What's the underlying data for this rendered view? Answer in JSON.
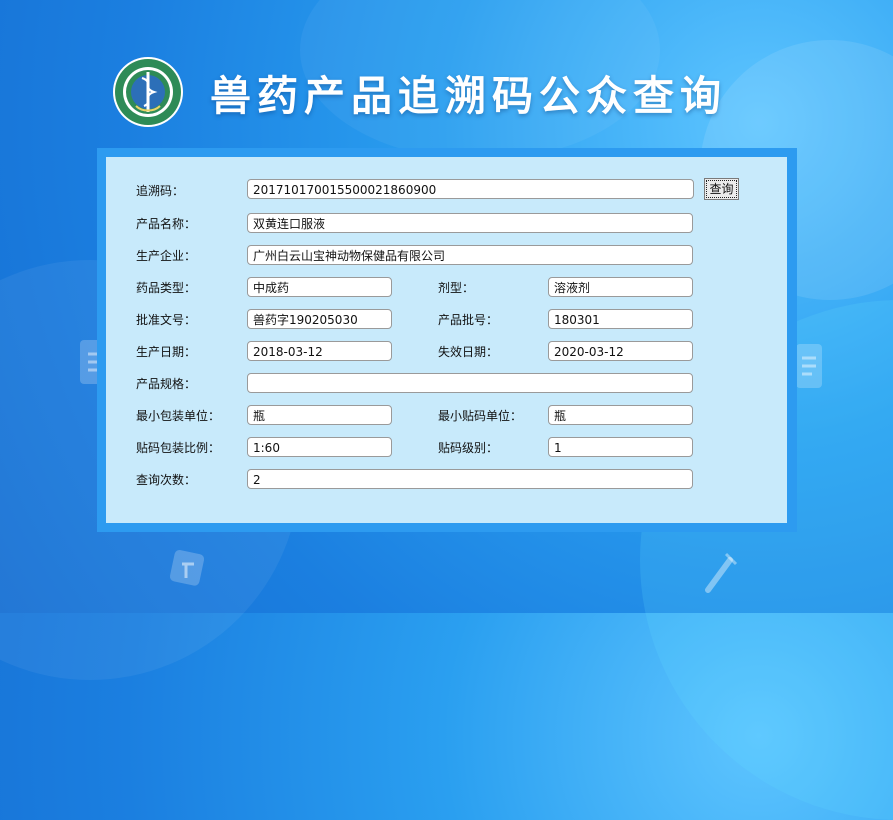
{
  "header": {
    "title": "兽药产品追溯码公众查询",
    "logo_name": "official-seal-logo"
  },
  "query": {
    "button_label": "查询"
  },
  "labels": {
    "trace_code": "追溯码：",
    "product_name": "产品名称：",
    "manufacturer": "生产企业：",
    "drug_type": "药品类型：",
    "dosage_form": "剂型：",
    "approval_no": "批准文号：",
    "batch_no": "产品批号：",
    "production_date": "生产日期：",
    "expiry_date": "失效日期：",
    "spec": "产品规格：",
    "min_pack_unit": "最小包装单位：",
    "min_label_unit": "最小贴码单位：",
    "label_ratio": "贴码包装比例：",
    "label_level": "贴码级别：",
    "query_count": "查询次数："
  },
  "values": {
    "trace_code": "20171017001550002186090​0",
    "product_name": "双黄连口服液",
    "manufacturer": "广州白云山宝神动物保健品有限公司",
    "drug_type": "中成药",
    "dosage_form": "溶液剂",
    "approval_no": "兽药字190205030",
    "batch_no": "180301",
    "production_date": "2018-03-12",
    "expiry_date": "2020-03-12",
    "spec": "",
    "min_pack_unit": "瓶",
    "min_label_unit": "瓶",
    "label_ratio": "1:60",
    "label_level": "1",
    "query_count": "2"
  },
  "colors": {
    "panel_border": "#2d9bf0",
    "panel_fill": "#c8eafb",
    "bg_top": "#5ec5ff",
    "bg_bottom": "#166fd3"
  }
}
